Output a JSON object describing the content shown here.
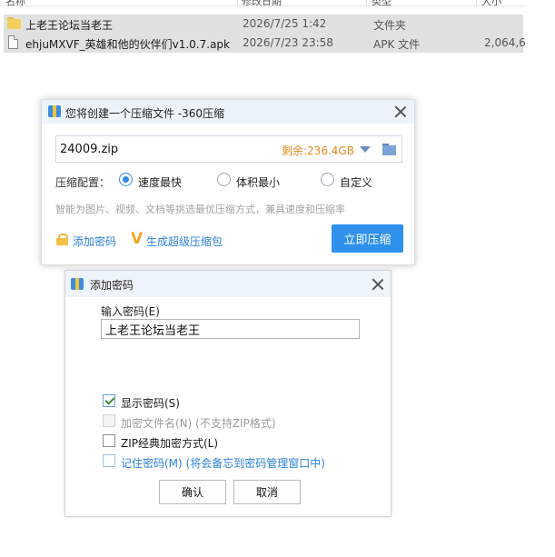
{
  "file_list": {
    "columns": [
      "名称",
      "修改日期",
      "类型",
      "大小"
    ],
    "rows": [
      {
        "name": "上老王论坛当老王",
        "date": "2026/7/25 1:42",
        "type": "文件夹",
        "size": "",
        "icon": "folder-icon"
      },
      {
        "name": "ehjuMXVF_英雄和他的伙伴们v1.0.7.apk",
        "date": "2026/7/23 23:58",
        "type": "APK 文件",
        "size": "2,064,6",
        "icon": "file-icon"
      }
    ]
  },
  "compress_dialog": {
    "title": "您将创建一个压缩文件 -360压缩",
    "filename": "24009.zip",
    "free_space": "剩余:236.4GB",
    "config_label": "压缩配置：",
    "options": [
      "速度最快",
      "体积最小",
      "自定义"
    ],
    "selected_option": "速度最快",
    "hint": "智能为图片、视频、文档等挑选最优压缩方式，兼具速度和压缩率",
    "add_password_link": "添加密码",
    "super_pack_link": "生成超级压缩包",
    "compress_button": "立即压缩",
    "accent_color": "#2e91ec",
    "space_color": "#e58a1f"
  },
  "password_dialog": {
    "title": "添加密码",
    "input_label": "输入密码(E)",
    "password_value": "上老王论坛当老王",
    "checkboxes": [
      {
        "label": "显示密码(S)",
        "checked": true,
        "enabled": true
      },
      {
        "label": "加密文件名(N) (不支持ZIP格式)",
        "checked": false,
        "enabled": false
      },
      {
        "label": "ZIP经典加密方式(L)",
        "checked": false,
        "enabled": true
      },
      {
        "label": "记住密码(M) (将会备忘到密码管理窗口中)",
        "checked": false,
        "enabled": true
      }
    ],
    "ok_button": "确认",
    "cancel_button": "取消"
  }
}
